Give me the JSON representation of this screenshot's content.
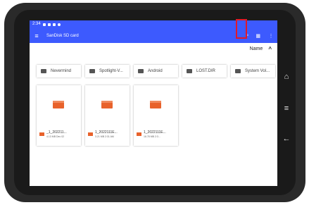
{
  "status_bar": {
    "time": "2:34"
  },
  "app_bar": {
    "title": "SanDisk SD card"
  },
  "sort": {
    "label": "Name",
    "arrow": "^"
  },
  "folders": [
    {
      "label": "Nevermind"
    },
    {
      "label": "Spotlight-V..."
    },
    {
      "label": "Android"
    },
    {
      "label": "LOST.DIR"
    },
    {
      "label": "System Vol..."
    }
  ],
  "files": [
    {
      "name": "_1_202211...",
      "meta": "4.13 MB Dec 02"
    },
    {
      "name": "1_2022111E...",
      "meta": "3.21 MB 2:31 AM"
    },
    {
      "name": "1_2022111E...",
      "meta": "16.78 MB 2:3..."
    }
  ],
  "icons": {
    "menu": "≡",
    "search": "⌕",
    "grid": "▦",
    "more": "⋮",
    "home": "⌂",
    "recents": "≡",
    "back": "←"
  },
  "colors": {
    "accent": "#3d5afe",
    "highlight": "#e0192a",
    "video": "#e8622b"
  }
}
